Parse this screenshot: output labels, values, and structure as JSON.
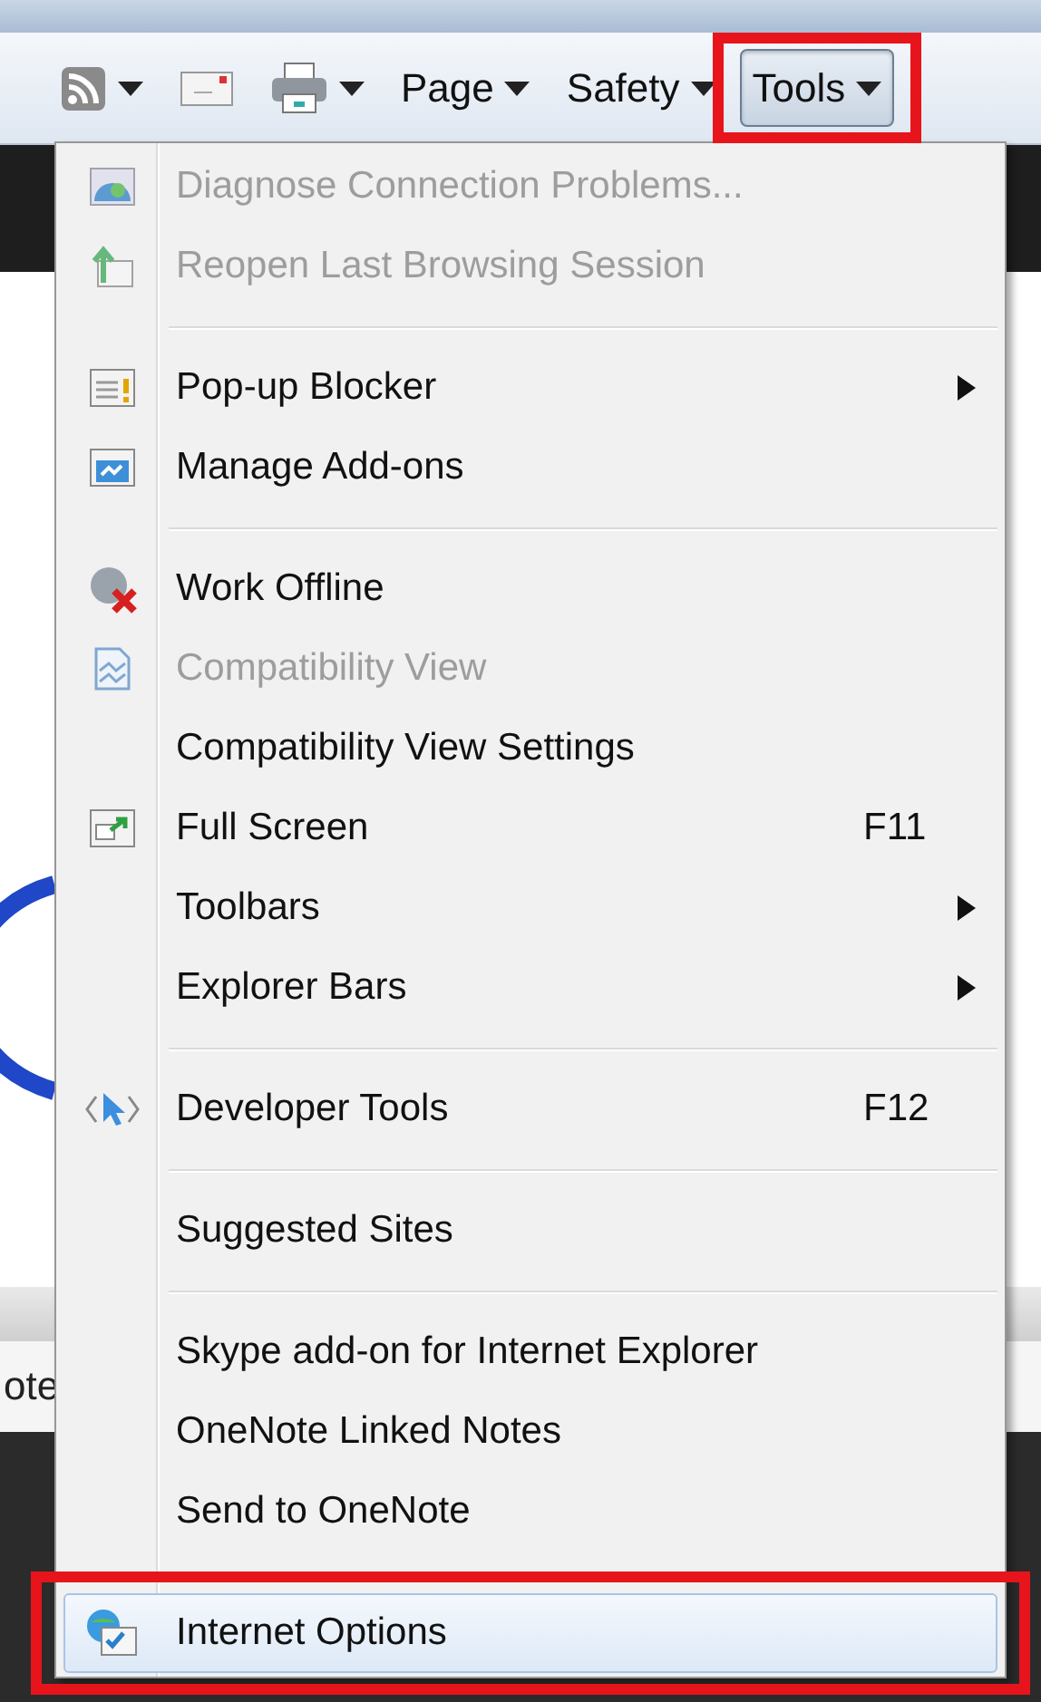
{
  "toolbar": {
    "items": [
      {
        "kind": "feed",
        "dropdown": true,
        "pressed": false,
        "marked": false
      },
      {
        "kind": "mail",
        "dropdown": false,
        "pressed": false,
        "marked": false
      },
      {
        "kind": "print",
        "dropdown": true,
        "pressed": false,
        "marked": false
      },
      {
        "kind": "menu",
        "label": "Page",
        "dropdown": true,
        "pressed": false,
        "marked": false
      },
      {
        "kind": "menu",
        "label": "Safety",
        "dropdown": true,
        "pressed": false,
        "marked": false
      },
      {
        "kind": "menu",
        "label": "Tools",
        "dropdown": true,
        "pressed": true,
        "marked": true
      }
    ]
  },
  "background": {
    "status_text": "ote"
  },
  "tools_menu": {
    "groups": [
      {
        "items": [
          {
            "kind": "diagnose",
            "label": "Diagnose Connection Problems...",
            "disabled": true,
            "selected": false,
            "submenu": false,
            "marked": false
          },
          {
            "kind": "reopen",
            "label": "Reopen Last Browsing Session",
            "disabled": true,
            "selected": false,
            "submenu": false,
            "marked": false
          }
        ]
      },
      {
        "items": [
          {
            "kind": "popup",
            "label": "Pop-up Blocker",
            "disabled": false,
            "selected": false,
            "submenu": true,
            "marked": false
          },
          {
            "kind": "addons",
            "label": "Manage Add-ons",
            "disabled": false,
            "selected": false,
            "submenu": false,
            "marked": false
          }
        ]
      },
      {
        "items": [
          {
            "kind": "offline",
            "label": "Work Offline",
            "disabled": false,
            "selected": false,
            "submenu": false,
            "marked": false
          },
          {
            "kind": "compat",
            "label": "Compatibility View",
            "disabled": true,
            "selected": false,
            "submenu": false,
            "marked": false
          },
          {
            "kind": "plain",
            "label": "Compatibility View Settings",
            "disabled": false,
            "selected": false,
            "submenu": false,
            "marked": false
          },
          {
            "kind": "fullscreen",
            "label": "Full Screen",
            "shortcut": "F11",
            "disabled": false,
            "selected": false,
            "submenu": false,
            "marked": false
          },
          {
            "kind": "plain",
            "label": "Toolbars",
            "disabled": false,
            "selected": false,
            "submenu": true,
            "marked": false
          },
          {
            "kind": "plain",
            "label": "Explorer Bars",
            "disabled": false,
            "selected": false,
            "submenu": true,
            "marked": false
          }
        ]
      },
      {
        "items": [
          {
            "kind": "devtools",
            "label": "Developer Tools",
            "shortcut": "F12",
            "disabled": false,
            "selected": false,
            "submenu": false,
            "marked": false
          }
        ]
      },
      {
        "items": [
          {
            "kind": "plain",
            "label": "Suggested Sites",
            "disabled": false,
            "selected": false,
            "submenu": false,
            "marked": false
          }
        ]
      },
      {
        "items": [
          {
            "kind": "plain",
            "label": "Skype add-on for Internet Explorer",
            "disabled": false,
            "selected": false,
            "submenu": false,
            "marked": false
          },
          {
            "kind": "plain",
            "label": "OneNote Linked Notes",
            "disabled": false,
            "selected": false,
            "submenu": false,
            "marked": false
          },
          {
            "kind": "plain",
            "label": "Send to OneNote",
            "disabled": false,
            "selected": false,
            "submenu": false,
            "marked": false
          }
        ]
      },
      {
        "items": [
          {
            "kind": "options",
            "label": "Internet Options",
            "disabled": false,
            "selected": true,
            "submenu": false,
            "marked": true
          }
        ]
      }
    ]
  }
}
